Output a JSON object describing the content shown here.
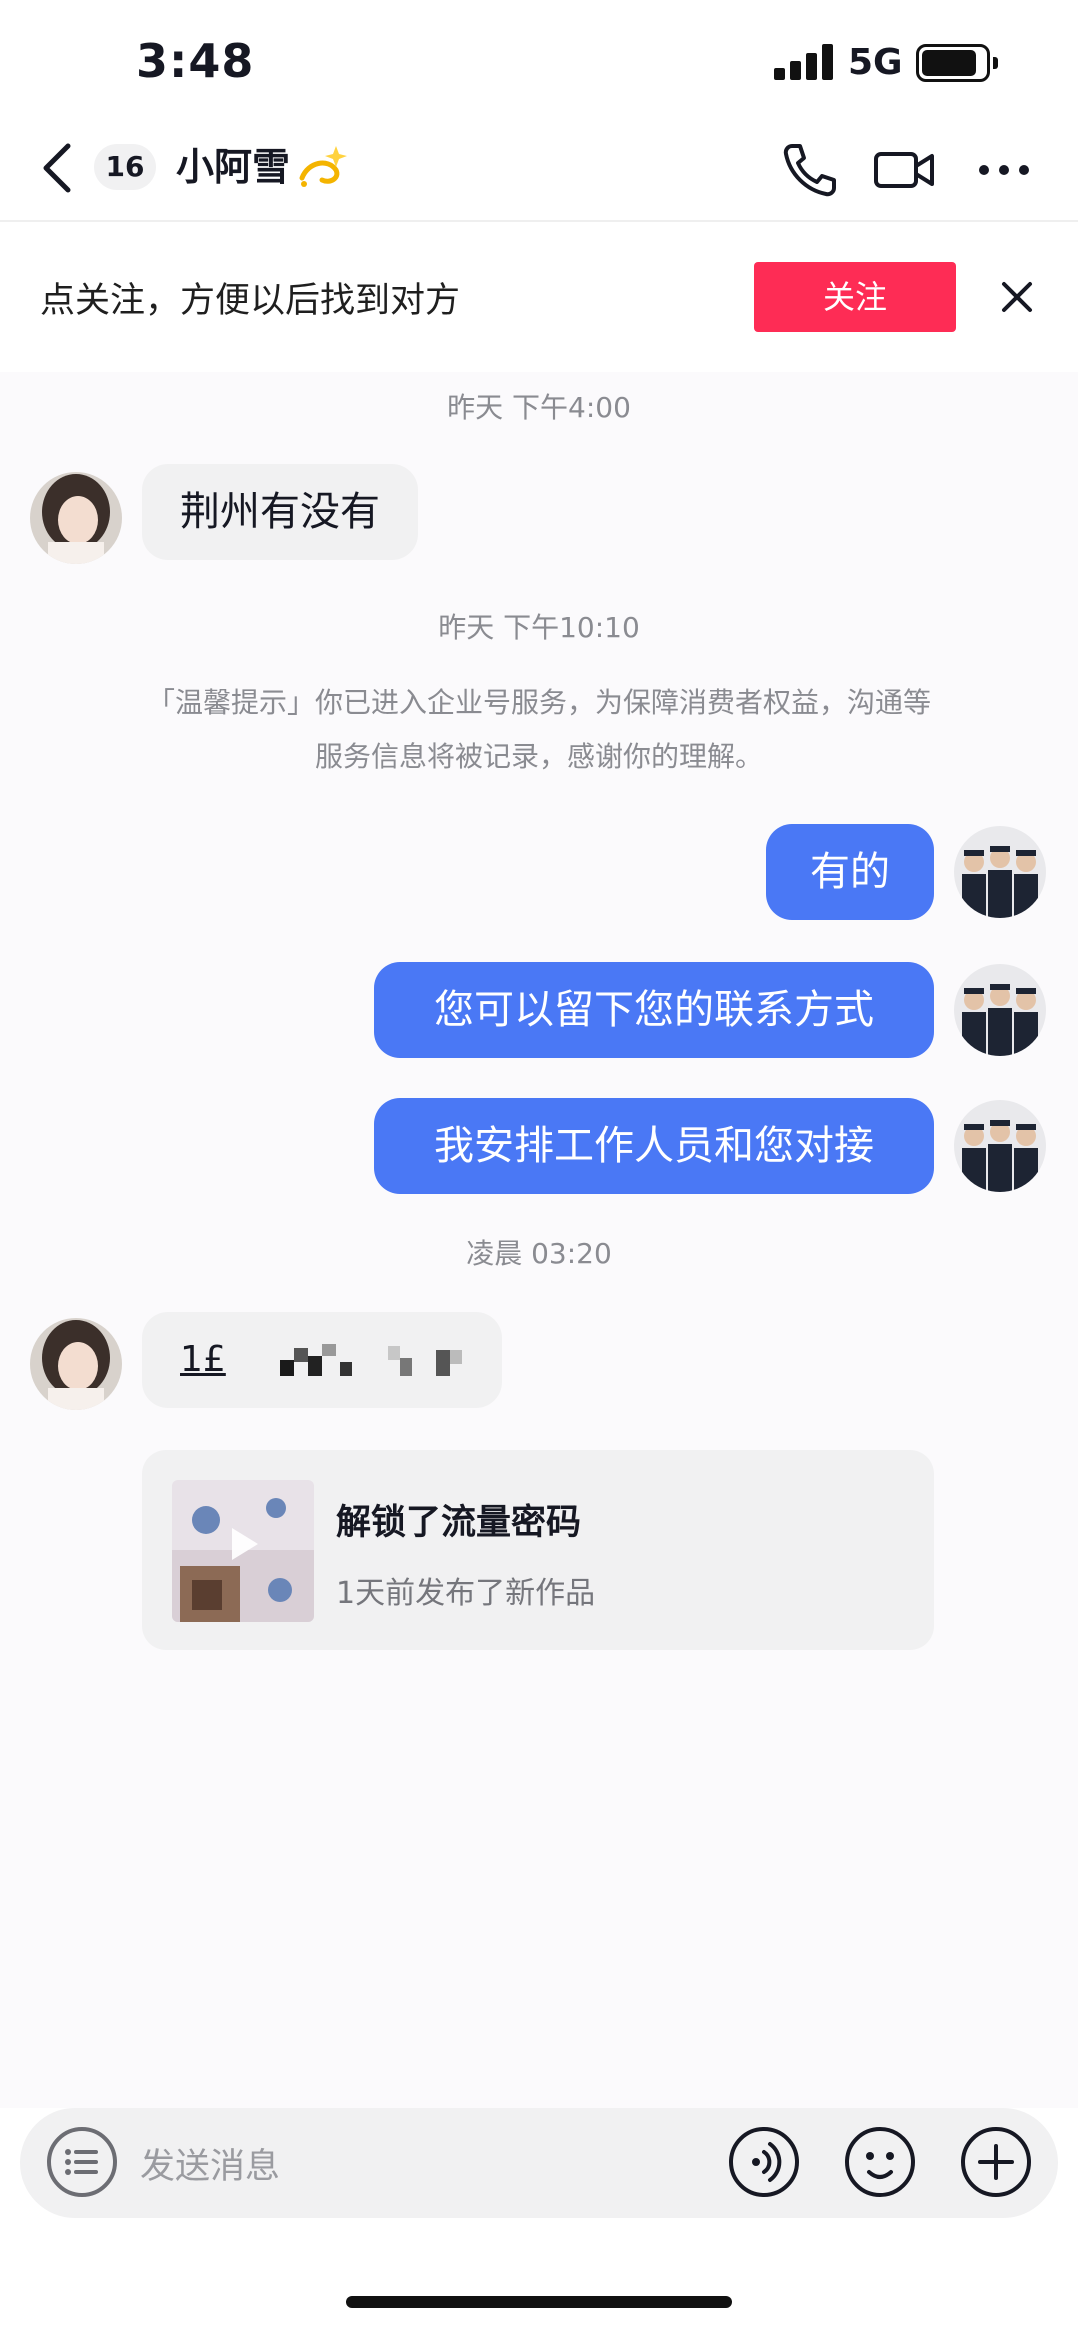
{
  "status_bar": {
    "time": "3:48",
    "network": "5G",
    "icons": [
      "signal-icon",
      "battery-icon"
    ]
  },
  "nav": {
    "back_icon": "chevron-left-icon",
    "unread_count": "16",
    "contact_name": "小阿雪",
    "name_emoji": "dizzy-emoji",
    "actions": [
      "phone-icon",
      "video-camera-icon",
      "more-icon"
    ]
  },
  "follow_banner": {
    "text": "点关注，方便以后找到对方",
    "button_label": "关注",
    "close_icon": "close-icon"
  },
  "messages": {
    "time_1": "昨天 下午4:00",
    "incoming_1": "荆州有没有",
    "time_2": "昨天 下午10:10",
    "notice_line_1": "「温馨提示」你已进入企业号服务，为保障消费者权益，沟通等",
    "notice_line_2": "服务信息将被记录，感谢你的理解。",
    "outgoing_1": "有的",
    "outgoing_2": "您可以留下您的联系方式",
    "outgoing_3": "我安排工作人员和您对接",
    "time_3": "凌晨 03:20",
    "incoming_2_visible": "1£",
    "incoming_2_redacted": true
  },
  "video_card": {
    "title": "解锁了流量密码",
    "subtitle": "1天前发布了新作品",
    "play_icon": "play-icon"
  },
  "input_bar": {
    "placeholder": "发送消息",
    "left_icon": "menu-list-icon",
    "right_icons": [
      "voice-icon",
      "emoji-icon",
      "plus-icon"
    ]
  },
  "colors": {
    "accent_red": "#fe2c55",
    "outgoing_bubble": "#4a78f5",
    "incoming_bubble": "#f1f1f2",
    "chat_background": "#fbfafc",
    "timestamp_gray": "#8a8b91"
  }
}
